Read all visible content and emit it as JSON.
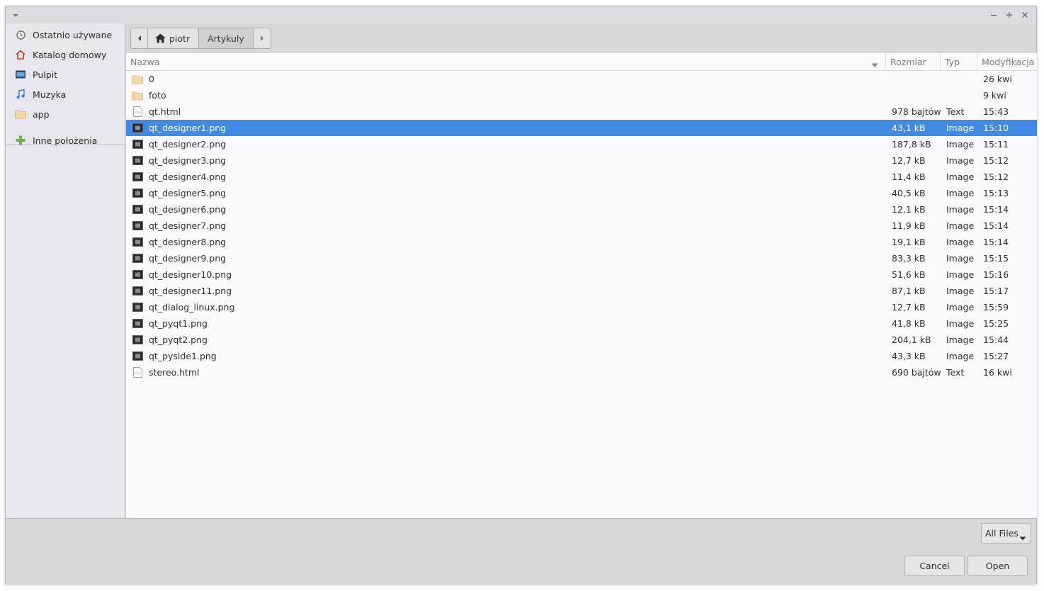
{
  "window": {
    "title": "",
    "controls": [
      "minimize-icon",
      "maximize-icon",
      "close-icon"
    ]
  },
  "sidebar": {
    "items": [
      {
        "label": "Ostatnio używane",
        "icon": "recent-icon"
      },
      {
        "label": "Katalog domowy",
        "icon": "home-icon"
      },
      {
        "label": "Pulpit",
        "icon": "desktop-icon"
      },
      {
        "label": "Muzyka",
        "icon": "music-icon"
      },
      {
        "label": "app",
        "icon": "folder-icon"
      }
    ],
    "other": {
      "label": "Inne położenia",
      "icon": "plus-icon"
    }
  },
  "pathbar": {
    "home": "piotr",
    "current": "Artykuly"
  },
  "columns": {
    "name": "Nazwa",
    "size": "Rozmiar",
    "type": "Typ",
    "modified": "Modyfikacja"
  },
  "files": [
    {
      "name": "0",
      "size": "",
      "type": "",
      "modified": "26 kwi",
      "kind": "folder"
    },
    {
      "name": "foto",
      "size": "",
      "type": "",
      "modified": "9 kwi",
      "kind": "folder"
    },
    {
      "name": "qt.html",
      "size": "978 bajtów",
      "type": "Text",
      "modified": "15:43",
      "kind": "text"
    },
    {
      "name": "qt_designer1.png",
      "size": "43,1 kB",
      "type": "Image",
      "modified": "15:10",
      "kind": "image",
      "selected": true
    },
    {
      "name": "qt_designer2.png",
      "size": "187,8 kB",
      "type": "Image",
      "modified": "15:11",
      "kind": "image"
    },
    {
      "name": "qt_designer3.png",
      "size": "12,7 kB",
      "type": "Image",
      "modified": "15:12",
      "kind": "image"
    },
    {
      "name": "qt_designer4.png",
      "size": "11,4 kB",
      "type": "Image",
      "modified": "15:12",
      "kind": "image"
    },
    {
      "name": "qt_designer5.png",
      "size": "40,5 kB",
      "type": "Image",
      "modified": "15:13",
      "kind": "image"
    },
    {
      "name": "qt_designer6.png",
      "size": "12,1 kB",
      "type": "Image",
      "modified": "15:14",
      "kind": "image"
    },
    {
      "name": "qt_designer7.png",
      "size": "11,9 kB",
      "type": "Image",
      "modified": "15:14",
      "kind": "image"
    },
    {
      "name": "qt_designer8.png",
      "size": "19,1 kB",
      "type": "Image",
      "modified": "15:14",
      "kind": "image"
    },
    {
      "name": "qt_designer9.png",
      "size": "83,3 kB",
      "type": "Image",
      "modified": "15:15",
      "kind": "image"
    },
    {
      "name": "qt_designer10.png",
      "size": "51,6 kB",
      "type": "Image",
      "modified": "15:16",
      "kind": "image"
    },
    {
      "name": "qt_designer11.png",
      "size": "87,1 kB",
      "type": "Image",
      "modified": "15:17",
      "kind": "image"
    },
    {
      "name": "qt_dialog_linux.png",
      "size": "12,7 kB",
      "type": "Image",
      "modified": "15:59",
      "kind": "image"
    },
    {
      "name": "qt_pyqt1.png",
      "size": "41,8 kB",
      "type": "Image",
      "modified": "15:25",
      "kind": "image"
    },
    {
      "name": "qt_pyqt2.png",
      "size": "204,1 kB",
      "type": "Image",
      "modified": "15:44",
      "kind": "image"
    },
    {
      "name": "qt_pyside1.png",
      "size": "43,3 kB",
      "type": "Image",
      "modified": "15:27",
      "kind": "image"
    },
    {
      "name": "stereo.html",
      "size": "690 bajtów",
      "type": "Text",
      "modified": "16 kwi",
      "kind": "text"
    }
  ],
  "footer": {
    "filter": "All Files",
    "cancel": "Cancel",
    "open": "Open"
  },
  "colors": {
    "selection": "#3f8ae2",
    "sidebar_bg": "#e6e6ec",
    "list_bg": "#fbfaff"
  }
}
